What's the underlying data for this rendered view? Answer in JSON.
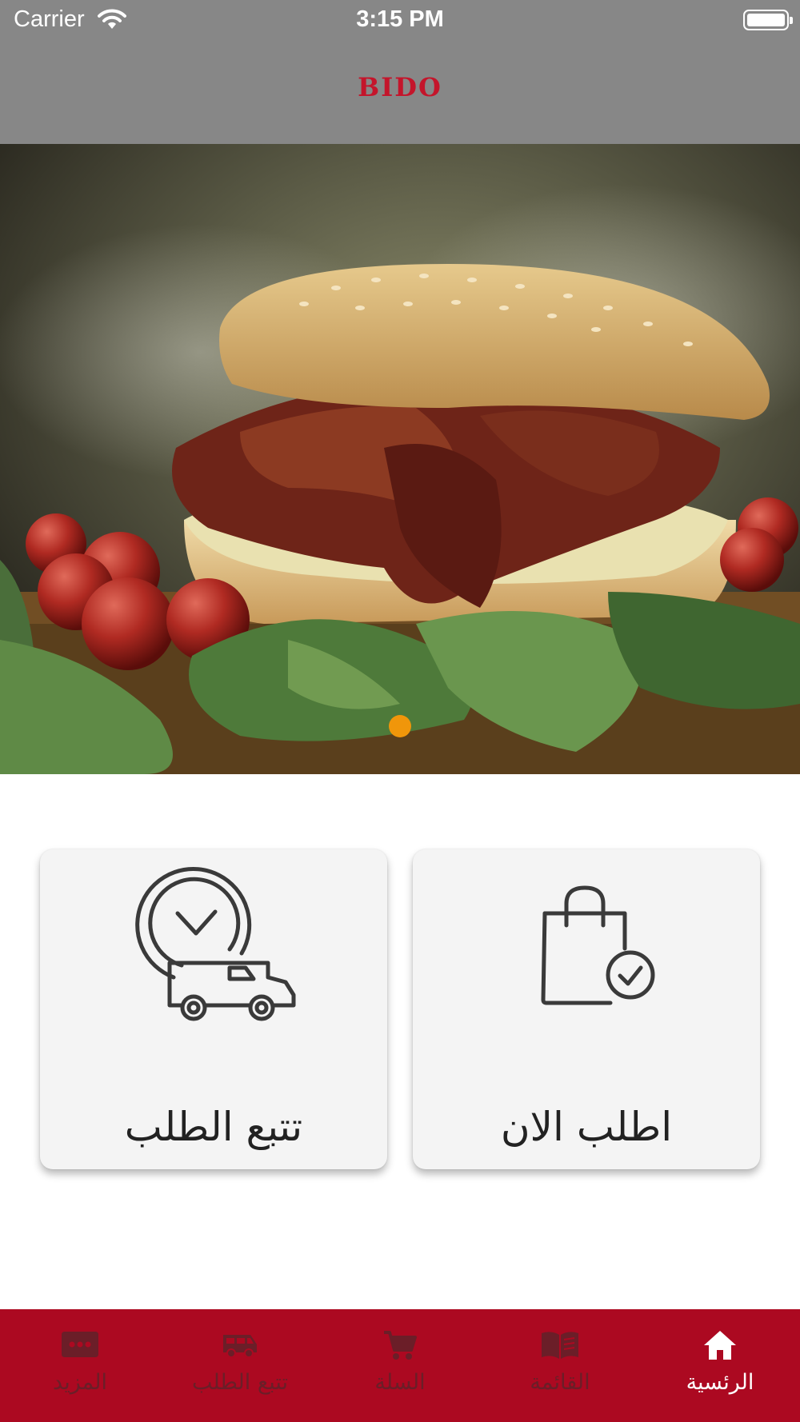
{
  "status_bar": {
    "carrier": "Carrier",
    "time": "3:15 PM",
    "icons": [
      "wifi-icon",
      "battery-icon"
    ]
  },
  "header": {
    "brand": "BIDO",
    "brand_color": "#c4152b",
    "background": "#878787"
  },
  "hero": {
    "image": "burger-photo",
    "pager_dots": 1,
    "active_dot_color": "#f0960a"
  },
  "actions": [
    {
      "label": "تتبع الطلب",
      "icon": "delivery-truck-clock-icon"
    },
    {
      "label": "اطلب الان",
      "icon": "shopping-bag-check-icon"
    }
  ],
  "tabbar": {
    "background": "#ac0921",
    "active_color": "#ffffff",
    "inactive_color": "#6b1e28",
    "items": [
      {
        "label": "المزيد",
        "icon": "more-icon"
      },
      {
        "label": "تتبع الطلب",
        "icon": "van-icon"
      },
      {
        "label": "السلة",
        "icon": "cart-icon"
      },
      {
        "label": "القائمة",
        "icon": "menu-book-icon"
      },
      {
        "label": "الرئسية",
        "icon": "home-icon",
        "active": true
      }
    ]
  }
}
